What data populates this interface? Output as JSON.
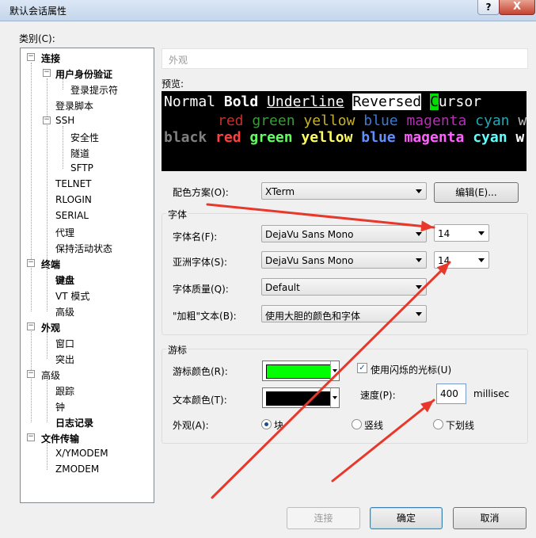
{
  "window": {
    "title": "默认会话属性",
    "help_label": "?",
    "close_label": "X"
  },
  "category_label": "类别(C):",
  "tree": {
    "items": [
      {
        "label": "连接",
        "bold": true
      },
      {
        "label": "用户身份验证",
        "bold": true
      },
      {
        "label": "登录提示符",
        "bold": false
      },
      {
        "label": "登录脚本",
        "bold": false
      },
      {
        "label": "SSH",
        "bold": false
      },
      {
        "label": "安全性",
        "bold": false
      },
      {
        "label": "隧道",
        "bold": false
      },
      {
        "label": "SFTP",
        "bold": false
      },
      {
        "label": "TELNET",
        "bold": false
      },
      {
        "label": "RLOGIN",
        "bold": false
      },
      {
        "label": "SERIAL",
        "bold": false
      },
      {
        "label": "代理",
        "bold": false
      },
      {
        "label": "保持活动状态",
        "bold": false
      },
      {
        "label": "终端",
        "bold": true
      },
      {
        "label": "键盘",
        "bold": true
      },
      {
        "label": "VT 模式",
        "bold": false
      },
      {
        "label": "高级",
        "bold": false
      },
      {
        "label": "外观",
        "bold": true
      },
      {
        "label": "窗口",
        "bold": false
      },
      {
        "label": "突出",
        "bold": false
      },
      {
        "label": "高级",
        "bold": false
      },
      {
        "label": "跟踪",
        "bold": false
      },
      {
        "label": "钟",
        "bold": false
      },
      {
        "label": "日志记录",
        "bold": true
      },
      {
        "label": "文件传输",
        "bold": true
      },
      {
        "label": "X/YMODEM",
        "bold": false
      },
      {
        "label": "ZMODEM",
        "bold": false
      }
    ],
    "toggle_minus": "−"
  },
  "breadcrumb": "外观",
  "preview_label": "预览:",
  "preview": {
    "line1": {
      "normal": "Normal ",
      "bold": "Bold",
      "sp1": " ",
      "underline": "Underline",
      "sp2": " ",
      "reversed": "Reversed",
      "sp3": " ",
      "cursor_char": "C",
      "cursor_rest": "ursor"
    },
    "colors_dim": [
      {
        "text": "red",
        "color": "#c4302b"
      },
      {
        "text": "green",
        "color": "#3a9a3a"
      },
      {
        "text": "yellow",
        "color": "#c8b030"
      },
      {
        "text": "blue",
        "color": "#3a7ad8"
      },
      {
        "text": "magenta",
        "color": "#b030b0"
      },
      {
        "text": "cyan",
        "color": "#20a8b8"
      },
      {
        "text": "w",
        "color": "#c0c0c0"
      }
    ],
    "colors_bright": [
      {
        "text": "black",
        "color": "#808080"
      },
      {
        "text": "red",
        "color": "#ff4040"
      },
      {
        "text": "green",
        "color": "#60ff60"
      },
      {
        "text": "yellow",
        "color": "#ffff60"
      },
      {
        "text": "blue",
        "color": "#6090ff"
      },
      {
        "text": "magenta",
        "color": "#ff60ff"
      },
      {
        "text": "cyan",
        "color": "#60ffff"
      },
      {
        "text": "w",
        "color": "#ffffff"
      }
    ]
  },
  "scheme": {
    "label": "配色方案(O):",
    "value": "XTerm",
    "edit_button": "编辑(E)..."
  },
  "font": {
    "group_title": "字体",
    "font_name_label": "字体名(F):",
    "font_name_value": "DejaVu Sans Mono",
    "font_size_value": "14",
    "asian_font_label": "亚洲字体(S):",
    "asian_font_value": "DejaVu Sans Mono",
    "asian_size_value": "14",
    "quality_label": "字体质量(Q):",
    "quality_value": "Default",
    "bold_label": "\"加粗\"文本(B):",
    "bold_value": "使用大胆的颜色和字体"
  },
  "cursor": {
    "group_title": "游标",
    "cursor_color_label": "游标颜色(R):",
    "cursor_color": "#00ff00",
    "text_color_label": "文本颜色(T):",
    "text_color": "#000000",
    "blink_label": "使用闪烁的光标(U)",
    "blink_checked": true,
    "check_mark": "✓",
    "speed_label": "速度(P):",
    "speed_value": "400",
    "speed_unit": "millisec",
    "appearance_label": "外观(A):",
    "options": [
      {
        "label": "块",
        "selected": true
      },
      {
        "label": "竖线",
        "selected": false
      },
      {
        "label": "下划线",
        "selected": false
      }
    ]
  },
  "buttons": {
    "connect": "连接",
    "ok": "确定",
    "cancel": "取消"
  },
  "annotation_color": "#e8382c"
}
